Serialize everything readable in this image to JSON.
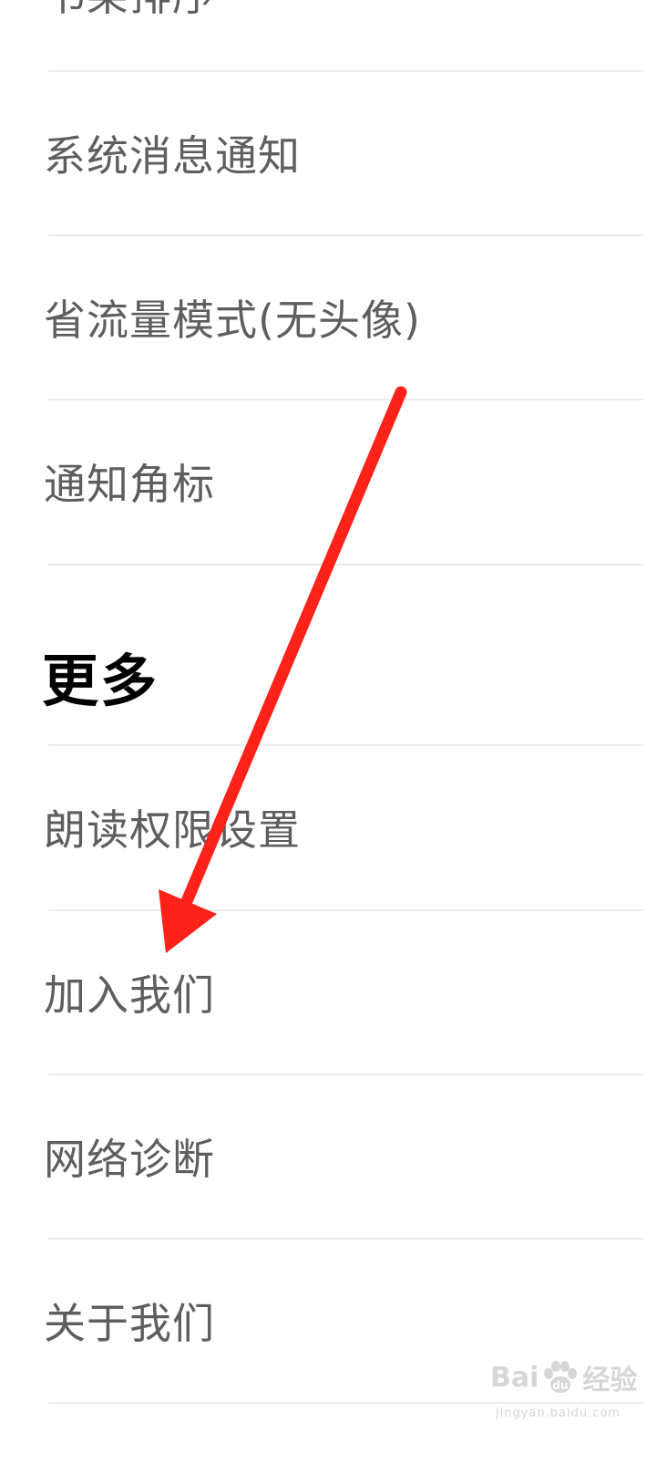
{
  "settings": {
    "items_top": [
      {
        "label": "书架排序"
      },
      {
        "label": "系统消息通知"
      },
      {
        "label": "省流量模式(无头像)"
      },
      {
        "label": "通知角标"
      }
    ],
    "section_more": {
      "title": "更多",
      "items": [
        {
          "label": "朗读权限设置"
        },
        {
          "label": "加入我们"
        },
        {
          "label": "网络诊断"
        },
        {
          "label": "关于我们"
        }
      ]
    }
  },
  "annotation": {
    "arrow_color": "#ff2219"
  },
  "watermark": {
    "brand_left": "Bai",
    "brand_right": "经验",
    "subtext": "jingyan.baidu.com"
  }
}
